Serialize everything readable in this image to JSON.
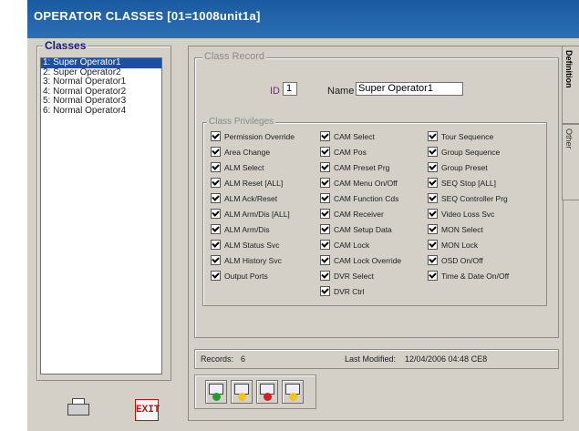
{
  "window": {
    "title": "OPERATOR CLASSES  [01=1008unit1a]"
  },
  "classes": {
    "legend": "Classes",
    "items": [
      "1: Super Operator1",
      "2: Super Operator2",
      "3: Normal Operator1",
      "4: Normal Operator2",
      "5: Normal Operator3",
      "6: Normal Operator4"
    ],
    "selected_index": 0
  },
  "record": {
    "legend": "Class Record",
    "id_label": "ID",
    "id_value": "1",
    "name_label": "Name",
    "name_value": "Super Operator1"
  },
  "privileges": {
    "legend": "Class Privileges",
    "col1": [
      "Permission Override",
      "Area Change",
      "ALM Select",
      "ALM Reset [ALL]",
      "ALM Ack/Reset",
      "ALM Arm/Dis [ALL]",
      "ALM Arm/Dis",
      "ALM Status Svc",
      "ALM History Svc",
      "Output Ports"
    ],
    "col2": [
      "CAM Select",
      "CAM Pos",
      "CAM Preset Prg",
      "CAM Menu On/Off",
      "CAM Function Cds",
      "CAM Receiver",
      "CAM Setup Data",
      "CAM Lock",
      "CAM Lock Override",
      "DVR Select",
      "DVR Ctrl"
    ],
    "col3": [
      "Tour Sequence",
      "Group Sequence",
      "Group Preset",
      "SEQ Stop [ALL]",
      "SEQ Controller Prg",
      "Video Loss Svc",
      "MON Select",
      "MON Lock",
      "OSD On/Off",
      "Time & Date On/Off"
    ],
    "all_checked": true
  },
  "status": {
    "records_label": "Records:",
    "records_value": "6",
    "modified_label": "Last Modified:",
    "modified_value": "12/04/2006 04:48 CE8"
  },
  "tabs": [
    "Definition",
    "Other"
  ],
  "nav_buttons": [
    {
      "name": "add-record-button",
      "dot_color": "#1fa02a"
    },
    {
      "name": "edit-record-button",
      "dot_color": "#f2c418"
    },
    {
      "name": "delete-record-button",
      "dot_color": "#d6201b"
    },
    {
      "name": "copy-record-button",
      "dot_color": "#f2c418"
    }
  ],
  "bottom": {
    "exit_label": "EXIT",
    "printer_icon": "printer-icon"
  },
  "colors": {
    "title_bar": "#1a5aa0",
    "selection": "#1b4fa0",
    "exit_red": "#c01010"
  }
}
